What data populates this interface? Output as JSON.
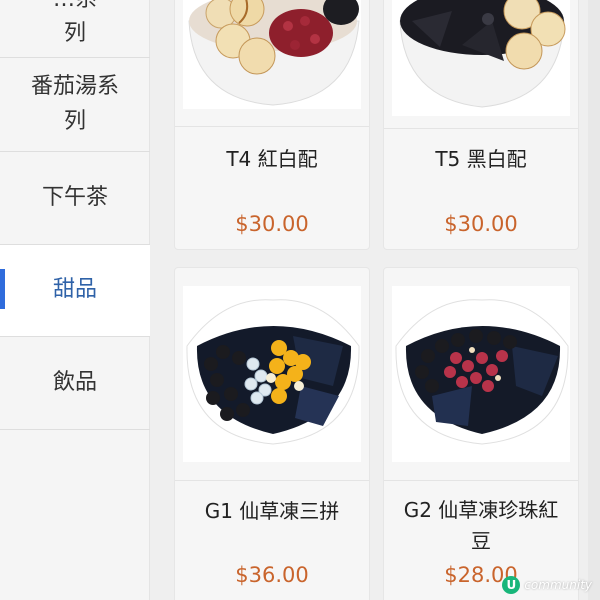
{
  "sidebar": {
    "items": [
      {
        "label": "…系\n列"
      },
      {
        "label": "番茄湯系\n列"
      },
      {
        "label": "下午茶"
      },
      {
        "label": "甜品",
        "active": true
      },
      {
        "label": "飲品"
      }
    ]
  },
  "products": [
    {
      "name": "T4 紅白配",
      "price": "$30.00",
      "image": "dessert-bowl-red-bean-taro-balls"
    },
    {
      "name": "T5 黑白配",
      "price": "$30.00",
      "image": "dessert-bowl-grass-jelly-taro-balls"
    },
    {
      "name": "G1 仙草凍三拼",
      "price": "$36.00",
      "image": "grass-jelly-three-toppings"
    },
    {
      "name": "G2 仙草凍珍珠紅豆",
      "price": "$28.00",
      "image": "grass-jelly-pearl-red-bean"
    }
  ],
  "watermark": {
    "mark": "U",
    "text": "community"
  },
  "colors": {
    "accent": "#2f6cdc",
    "active_text": "#2f62a8",
    "price": "#c9642c"
  }
}
